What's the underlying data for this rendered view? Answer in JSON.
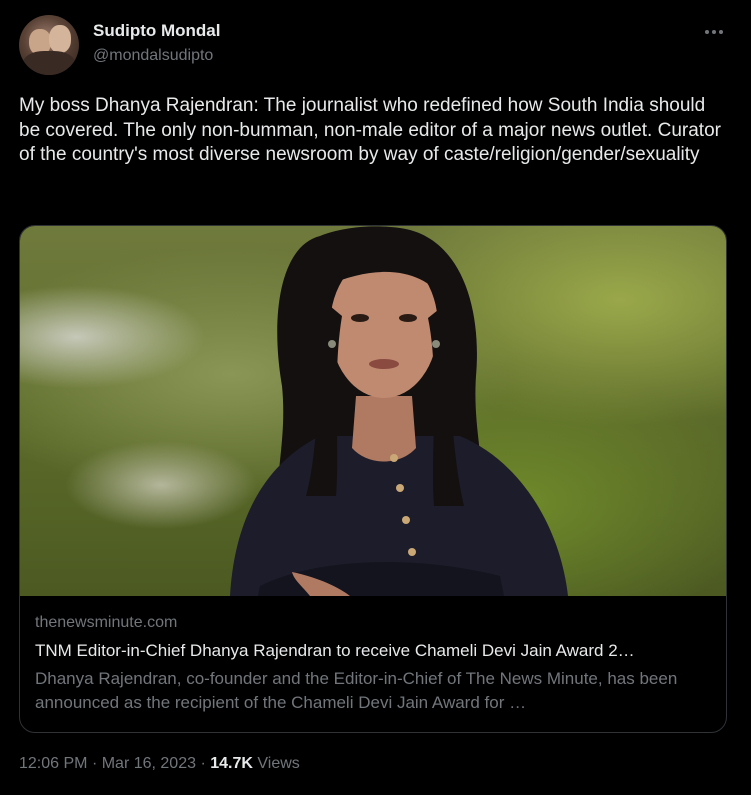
{
  "author": {
    "display_name": "Sudipto Mondal",
    "handle": "@mondalsudipto",
    "avatar_icon": "profile-photo"
  },
  "more_icon": "more-horizontal-icon",
  "tweet": {
    "text": "My boss Dhanya Rajendran: The journalist who redefined how South India should be covered. The only non-bumman, non-male editor of a major news outlet. Curator of the country's most diverse newsroom by way of caste/religion/gender/sexuality"
  },
  "link_card": {
    "domain": "thenewsminute.com",
    "title": "TNM Editor-in-Chief Dhanya Rajendran to receive Chameli Devi Jain Award 2…",
    "description": "Dhanya Rajendran, co-founder and the Editor-in-Chief of The News Minute, has been announced as the recipient of the Chameli Devi Jain Award for …"
  },
  "meta": {
    "time": "12:06 PM",
    "separator": "·",
    "date": "Mar 16, 2023",
    "views_count": "14.7K",
    "views_label": "Views"
  },
  "colors": {
    "background": "#000000",
    "primary_text": "#e7e9ea",
    "secondary_text": "#71767b",
    "border": "#2f3336"
  }
}
